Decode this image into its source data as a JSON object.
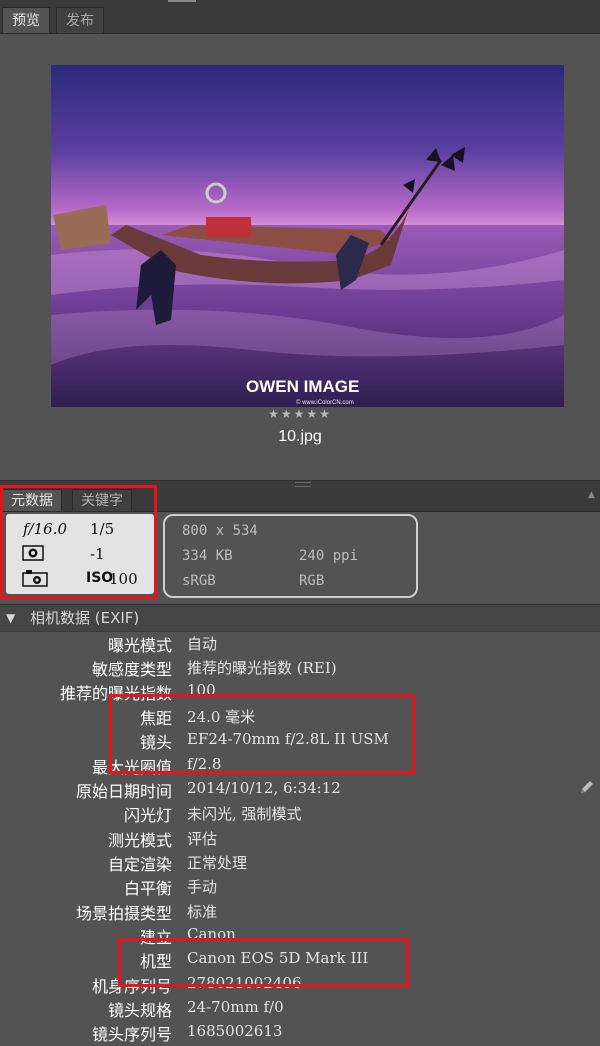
{
  "top_tabs": {
    "preview": "预览",
    "publish": "发布"
  },
  "preview": {
    "watermark_title": "OWEN IMAGE",
    "watermark_url": "© www.iColorCN.com",
    "rating": "★★★★★",
    "filename": "10.jpg"
  },
  "meta_tabs": {
    "metadata": "元数据",
    "keywords": "关键字"
  },
  "exposure": {
    "aperture": "𝑓/16.0",
    "shutter": "1/5",
    "exposure_comp": "-1",
    "iso_label": "ISO",
    "iso_value": "100"
  },
  "info": {
    "dimensions": "800 x 534",
    "filesize": "334 KB",
    "resolution": "240 ppi",
    "color_profile": "sRGB",
    "color_mode": "RGB"
  },
  "exif": {
    "section_title": "相机数据 (EXIF)",
    "rows": [
      {
        "label": "曝光模式",
        "value": "自动"
      },
      {
        "label": "敏感度类型",
        "value": "推荐的曝光指数 (REI)"
      },
      {
        "label": "推荐的曝光指数",
        "value": "100"
      },
      {
        "label": "焦距",
        "value": "24.0 毫米"
      },
      {
        "label": "镜头",
        "value": "EF24-70mm f/2.8L II USM"
      },
      {
        "label": "最大光圈值",
        "value": "f/2.8"
      },
      {
        "label": "原始日期时间",
        "value": "2014/10/12, 6:34:12"
      },
      {
        "label": "闪光灯",
        "value": "未闪光, 强制模式"
      },
      {
        "label": "测光模式",
        "value": "评估"
      },
      {
        "label": "自定渲染",
        "value": "正常处理"
      },
      {
        "label": "白平衡",
        "value": "手动"
      },
      {
        "label": "场景拍摄类型",
        "value": "标准"
      },
      {
        "label": "建立",
        "value": "Canon"
      },
      {
        "label": "机型",
        "value": "Canon EOS 5D Mark III"
      },
      {
        "label": "机身序列号",
        "value": "278021002406"
      },
      {
        "label": "镜头规格",
        "value": "24-70mm f/0"
      },
      {
        "label": "镜头序列号",
        "value": "1685002613"
      }
    ]
  },
  "colors": {
    "highlight_box": "#e8141b",
    "panel_bg": "#535353",
    "tab_bar": "#3a3a3a"
  }
}
